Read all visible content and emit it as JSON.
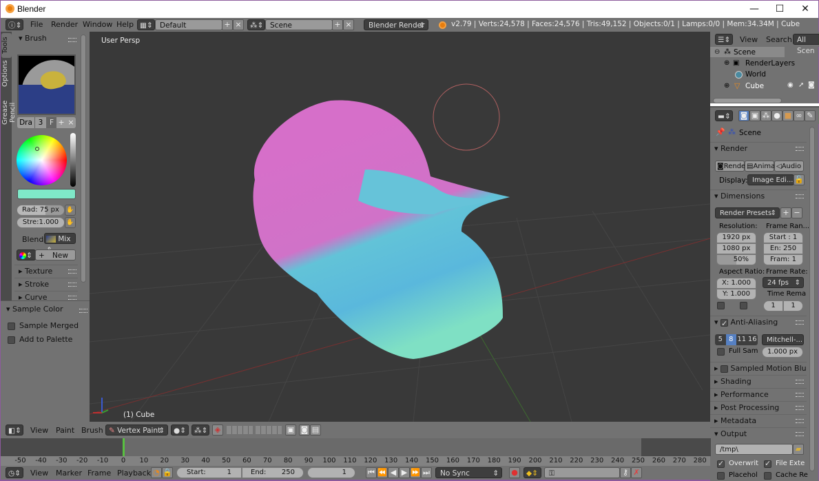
{
  "window": {
    "title": "Blender",
    "controls": {
      "minimize": "—",
      "maximize": "☐",
      "close": "✕"
    }
  },
  "topbar": {
    "menus": [
      "File",
      "Render",
      "Window",
      "Help"
    ],
    "layout": "Default",
    "scene": "Scene",
    "engine": "Blender Render",
    "stats": "v2.79 | Verts:24,578 | Faces:24,576 | Tris:49,152 | Objects:0/1 | Lamps:0/0 | Mem:34.34M | Cube"
  },
  "shelf": {
    "tabs": [
      "Tools",
      "Options",
      "Grease Pencil"
    ],
    "brush_panel": "Brush",
    "brush_name": "Dra",
    "brush_users": "3",
    "brush_fake": "F",
    "color_hex": "#7fe8c8",
    "radius": "Rad: 75 px",
    "strength": "Stre:1.000",
    "blend_label": "Blend:",
    "blend_value": "Mix",
    "new_label": "New",
    "subpanels": [
      "Texture",
      "Stroke",
      "Curve"
    ],
    "sample_panel": "Sample Color",
    "sample_merged": "Sample Merged",
    "add_palette": "Add to Palette"
  },
  "viewport": {
    "view_label": "User Persp",
    "object_label": "(1) Cube"
  },
  "outliner": {
    "menus": [
      "View",
      "Search"
    ],
    "filter": "All Scen",
    "tree": [
      {
        "name": "Scene",
        "level": 0
      },
      {
        "name": "RenderLayers",
        "level": 1
      },
      {
        "name": "World",
        "level": 1
      },
      {
        "name": "Cube",
        "level": 1
      }
    ]
  },
  "props": {
    "context": "Scene",
    "render_panel": "Render",
    "render_buttons": [
      "Rende",
      "Anima",
      "Audio"
    ],
    "display_label": "Display:",
    "display_value": "Image Edi...",
    "dimensions_panel": "Dimensions",
    "presets": "Render Presets",
    "resolution_label": "Resolution:",
    "res_x": "1920 px",
    "res_y": "1080 px",
    "res_pct": "50%",
    "frame_range_label": "Frame Ran...",
    "start": "Start : 1",
    "end": "En: 250",
    "step": "Fram: 1",
    "aspect_label": "Aspect Ratio:",
    "aspect_x": "X: 1.000",
    "aspect_y": "Y: 1.000",
    "frame_rate_label": "Frame Rate:",
    "frame_rate": "24 fps",
    "time_remap_label": "Time Rema",
    "remap_old": "1",
    "remap_new": "1",
    "aa_panel": "Anti-Aliasing",
    "aa_samples": [
      "5",
      "8",
      "11",
      "16"
    ],
    "aa_selected": "8",
    "aa_filter": "Mitchell-...",
    "full_sample": "Full Sam",
    "filter_size": "1.000 px",
    "collapsed": [
      "Sampled Motion Blu",
      "Shading",
      "Performance",
      "Post Processing",
      "Metadata"
    ],
    "output_panel": "Output",
    "output_path": "/tmp\\",
    "overwrite": "Overwrit",
    "file_ext": "File Exte",
    "placeholders": "Placehol",
    "cache": "Cache Re"
  },
  "vphead": {
    "menus": [
      "View",
      "Paint",
      "Brush"
    ],
    "mode": "Vertex Paint"
  },
  "timeline": {
    "ticks": [
      "-50",
      "-40",
      "-30",
      "-20",
      "-10",
      "0",
      "10",
      "20",
      "30",
      "40",
      "50",
      "60",
      "70",
      "80",
      "90",
      "100",
      "110",
      "120",
      "130",
      "140",
      "150",
      "160",
      "170",
      "180",
      "190",
      "200",
      "210",
      "220",
      "230",
      "240",
      "250",
      "260",
      "270",
      "280"
    ],
    "menus": [
      "View",
      "Marker",
      "Frame",
      "Playback"
    ],
    "start_label": "Start:",
    "start": "1",
    "end_label": "End:",
    "end": "250",
    "current": "1",
    "sync": "No Sync"
  }
}
